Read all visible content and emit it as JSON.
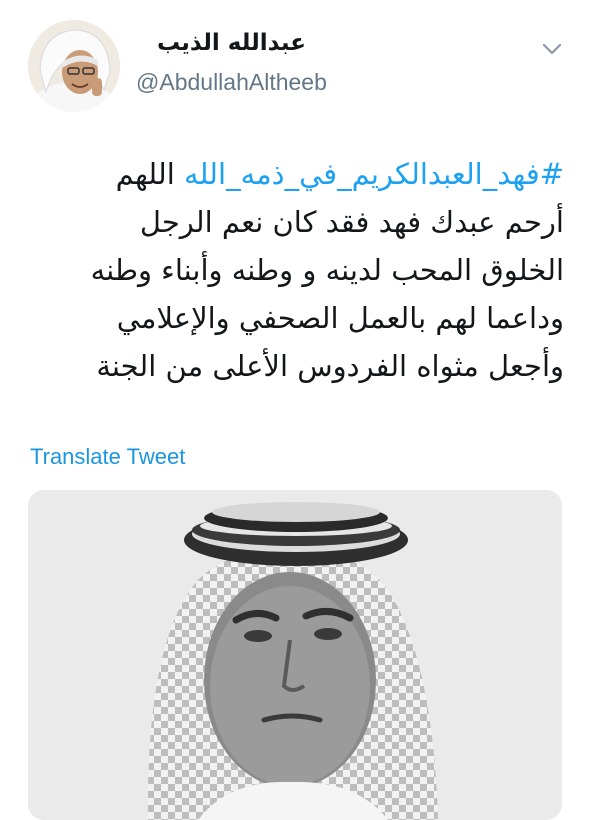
{
  "author": {
    "display_name": "عبدالله الذيب",
    "handle": "@AbdullahAltheeb"
  },
  "tweet": {
    "hashtag": "#فهد_العبدالكريم_في_ذمه_الله",
    "line1_rest": " اللهم",
    "line2": "أرحم عبدك فهد فقد كان نعم الرجل",
    "line3": "الخلوق المحب لدينه و وطنه وأبناء وطنه",
    "line4": "وداعما لهم بالعمل الصحفي والإعلامي",
    "line5": "وأجعل مثواه الفردوس الأعلى من الجنة"
  },
  "actions": {
    "translate_label": "Translate Tweet"
  },
  "icons": {
    "menu": "chevron-down-icon"
  },
  "colors": {
    "link": "#1da1f2",
    "handle": "#657786",
    "text": "#14171a"
  }
}
